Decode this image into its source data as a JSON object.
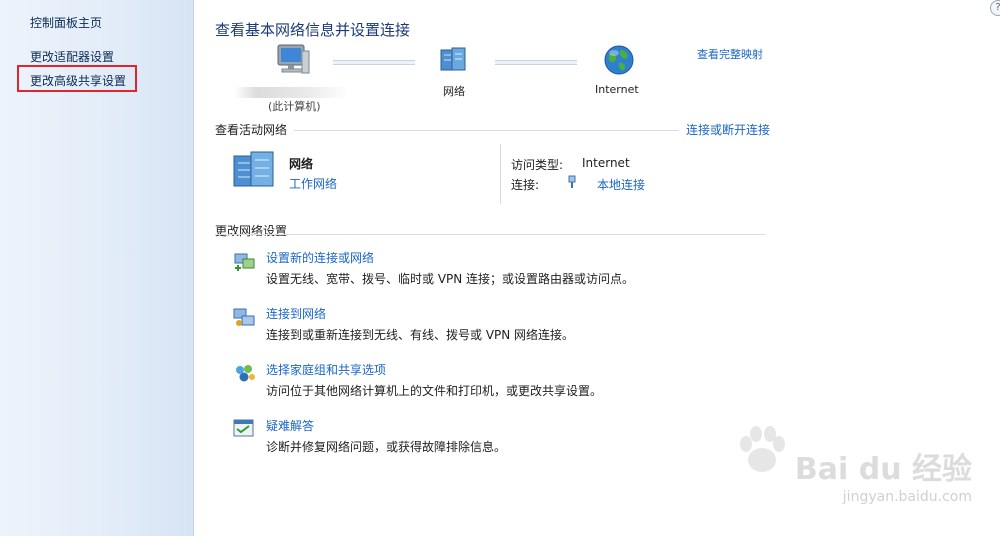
{
  "sidebar": {
    "home": "控制面板主页",
    "adapter_settings": "更改适配器设置",
    "advanced_sharing": "更改高级共享设置"
  },
  "header": {
    "title": "查看基本网络信息并设置连接",
    "full_map_link": "查看完整映射"
  },
  "map": {
    "computer_label": "(此计算机)",
    "network_label": "网络",
    "internet_label": "Internet"
  },
  "active_networks": {
    "heading": "查看活动网络",
    "connect_link": "连接或断开连接",
    "network_name": "网络",
    "network_type": "工作网络",
    "access_type_label": "访问类型:",
    "access_type_value": "Internet",
    "connection_label": "连接:",
    "connection_value": "本地连接"
  },
  "change_settings": {
    "heading": "更改网络设置",
    "tasks": [
      {
        "title": "设置新的连接或网络",
        "desc": "设置无线、宽带、拨号、临时或 VPN 连接；或设置路由器或访问点。"
      },
      {
        "title": "连接到网络",
        "desc": "连接到或重新连接到无线、有线、拨号或 VPN 网络连接。"
      },
      {
        "title": "选择家庭组和共享选项",
        "desc": "访问位于其他网络计算机上的文件和打印机，或更改共享设置。"
      },
      {
        "title": "疑难解答",
        "desc": "诊断并修复网络问题，或获得故障排除信息。"
      }
    ]
  },
  "watermark": {
    "brand": "Bai du 经验",
    "url": "jingyan.baidu.com"
  },
  "colors": {
    "link": "#1a66c8",
    "title": "#1b3a7a",
    "highlight": "#e0262b"
  }
}
